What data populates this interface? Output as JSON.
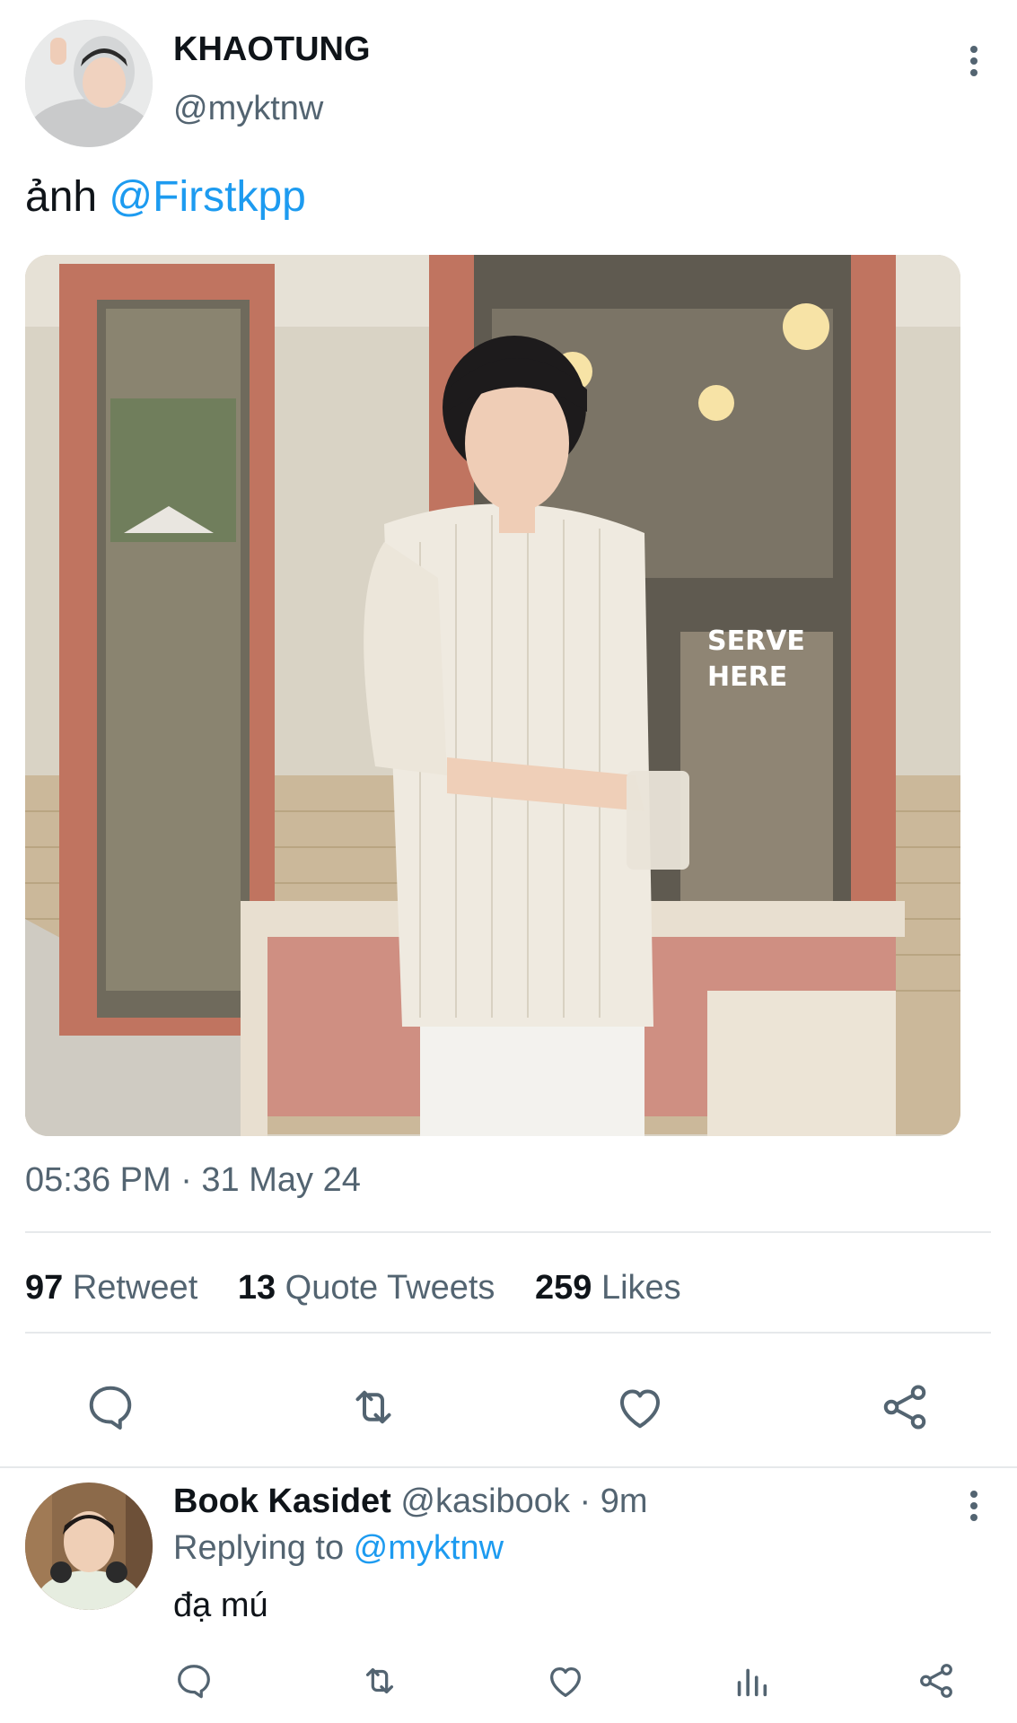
{
  "tweet": {
    "author": {
      "display_name": "KHAOTUNG",
      "handle": "@myktnw"
    },
    "text_prefix": "ảnh ",
    "mention": "@Firstkpp",
    "timestamp": "05:36 PM · 31 May 24",
    "stats": {
      "retweets_count": "97",
      "retweets_label": "Retweet",
      "quotes_count": "13",
      "quotes_label": "Quote Tweets",
      "likes_count": "259",
      "likes_label": "Likes"
    },
    "actions": [
      "reply-icon",
      "retweet-icon",
      "like-icon",
      "share-icon"
    ]
  },
  "reply": {
    "display_name": "Book Kasidet",
    "handle": "@kasibook",
    "separator": " · ",
    "time": "9m",
    "replying_prefix": "Replying to ",
    "replying_to": "@myktnw",
    "text": "đạ mú",
    "actions": [
      "reply-icon",
      "retweet-icon",
      "like-icon",
      "analytics-icon",
      "share-icon"
    ]
  },
  "colors": {
    "accent": "#1d9bf0",
    "text": "#0f1419",
    "muted": "#536471",
    "divider": "#e6e9eb"
  }
}
